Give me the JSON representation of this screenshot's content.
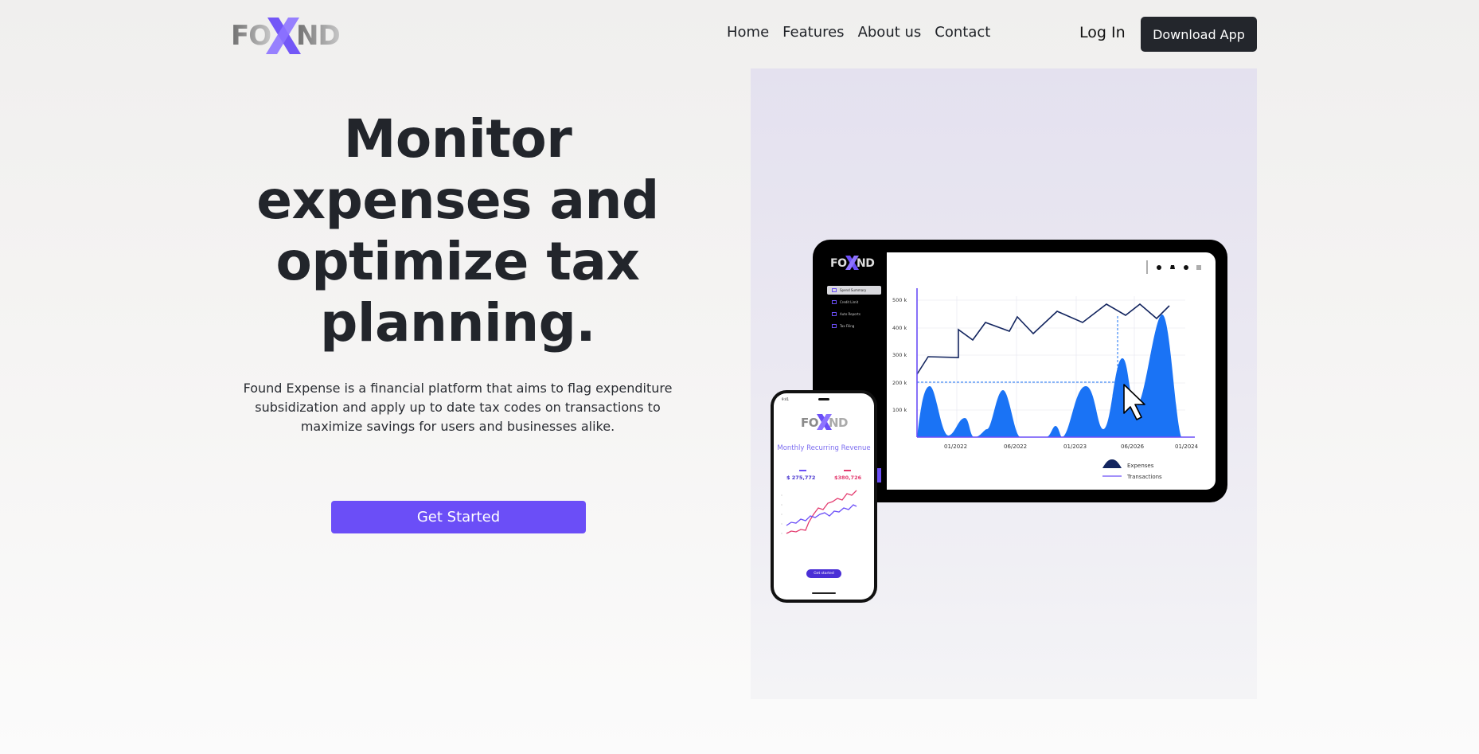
{
  "brand": {
    "logo_text": "FOUND",
    "logo_mark": "X",
    "accent": "#6b4ef7",
    "dark": "#23262c"
  },
  "nav": {
    "links": [
      "Home",
      "Features",
      "About us",
      "Contact"
    ],
    "login": "Log In",
    "download": "Download App"
  },
  "hero": {
    "title_lines": [
      "Monitor",
      "expenses and",
      "optimize tax",
      "planning."
    ],
    "description": "Found Expense is a financial platform that aims to flag expenditure subsidization and apply up to date tax codes on transactions to maximize savings for users and businesses alike.",
    "cta": "Get Started"
  },
  "tablet": {
    "sidebar_items": [
      "Spend Summary",
      "Credit Limit",
      "Auto Reports",
      "Tax Filing"
    ],
    "chart": {
      "y_ticks": [
        "100 k",
        "200 k",
        "300 k",
        "400 k",
        "500 k"
      ],
      "x_ticks": [
        "01/2022",
        "06/2022",
        "01/2023",
        "06/2026",
        "01/2024"
      ],
      "legend": [
        "Expenses",
        "Transactions"
      ]
    }
  },
  "phone": {
    "status_time": "9:41",
    "title": "Monthly Recurring Revenue",
    "value1": "$ 275,772",
    "value2": "$380,726",
    "button": "Get started"
  }
}
